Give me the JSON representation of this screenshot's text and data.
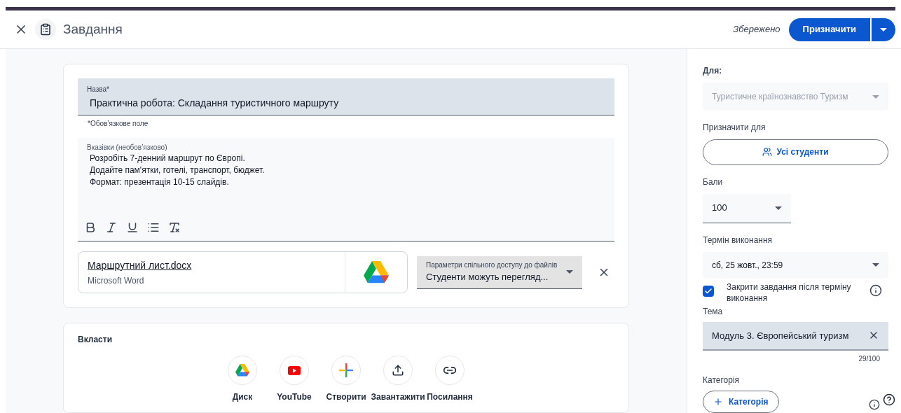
{
  "header": {
    "title": "Завдання",
    "saved": "Збережено",
    "assign_button": "Призначити"
  },
  "form": {
    "title_field": {
      "label": "Назва*",
      "value": "Практична робота: Складання туристичного маршруту",
      "helper": "*Обов’язкове поле"
    },
    "instructions": {
      "label": "Вказівки (необов’язково)",
      "lines": [
        "Розробіть 7-денний маршрут по Європі.",
        "Додайте пам'ятки, готелі, транспорт, бюджет.",
        "Формат: презентація 10-15 слайдів."
      ]
    },
    "formatting": [
      {
        "kind": "bold"
      },
      {
        "kind": "italic"
      },
      {
        "kind": "underline"
      },
      {
        "kind": "list"
      },
      {
        "kind": "clear"
      }
    ],
    "attachment": {
      "name": "Маршрутний лист.docx",
      "type": "Microsoft Word",
      "sharing_label": "Параметри спільного доступу до файлів",
      "sharing_value": "Студенти можуть перегляд..."
    }
  },
  "attach": {
    "title": "Вкласти",
    "items": [
      {
        "kind": "drive",
        "label": "Диск"
      },
      {
        "kind": "youtube",
        "label": "YouTube"
      },
      {
        "kind": "create",
        "label": "Створити"
      },
      {
        "kind": "upload",
        "label": "Завантажити"
      },
      {
        "kind": "link",
        "label": "Посилання"
      }
    ]
  },
  "sidebar": {
    "for_label": "Для:",
    "class_value": "Туристичне країнознавство Туризм",
    "assign_to_label": "Призначити для",
    "assign_to_button": "Усі студенти",
    "points_label": "Бали",
    "points_value": "100",
    "due_label": "Термін виконання",
    "due_value": "сб, 25 жовт., 23:59",
    "close_after": {
      "label": "Закрити завдання після терміну виконання",
      "checked": true
    },
    "topic_label": "Тема",
    "topic_value": "Модуль 3. Європейський туризм",
    "topic_count": "29/100",
    "category_label": "Категорія",
    "category_button": "Категорія"
  }
}
